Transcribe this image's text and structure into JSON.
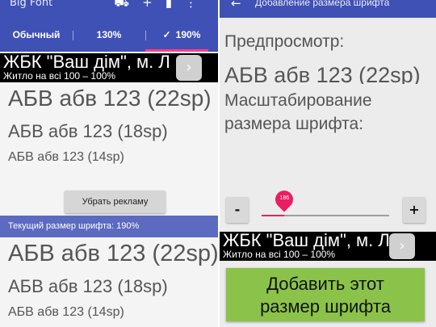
{
  "left": {
    "app_title": "Big Font",
    "tabs": [
      {
        "label": "Обычный"
      },
      {
        "label": "130%"
      },
      {
        "label": "190%",
        "check": "✓",
        "selected": true
      }
    ],
    "ad": {
      "line1": "ЖБК \"Ваш дім\", м. Л",
      "line2": "Житло на всі 100 – 100%",
      "arrow": "›"
    },
    "preview_top": [
      "АБВ абв 123 (22sp)",
      "АБВ абв 123 (18sp)",
      "АБВ абв 123 (14sp)"
    ],
    "remove_ads_label": "Убрать рекламу",
    "current_size_label": "Текущий размер шрифта: 190%",
    "preview_bottom": [
      "АБВ абв 123 (22sp)",
      "АБВ абв 123 (18sp)",
      "АБВ абв 123 (14sp)"
    ]
  },
  "right": {
    "title": "Добавление размера шрифта",
    "back_icon": "←",
    "preview_label": "Предпросмотр:",
    "preview_sample": "АБВ абв 123 (22sp)",
    "scale_label_line1": "Масштабирование",
    "scale_label_line2": "размера шрифта:",
    "minus_label": "-",
    "plus_label": "+",
    "seek_value": "186",
    "seek_fraction": 0.18,
    "ad": {
      "line1": "ЖБК \"Ваш дім\", м. Л",
      "line2": "Житло на всі 100 – 100%",
      "arrow": "›"
    },
    "add_button_line1": "Добавить этот",
    "add_button_line2": "размер шрифта"
  },
  "colors": {
    "primary": "#3f51b5",
    "accent": "#ff4081",
    "seek": "#e91e63",
    "add_button": "#8bc34a"
  }
}
